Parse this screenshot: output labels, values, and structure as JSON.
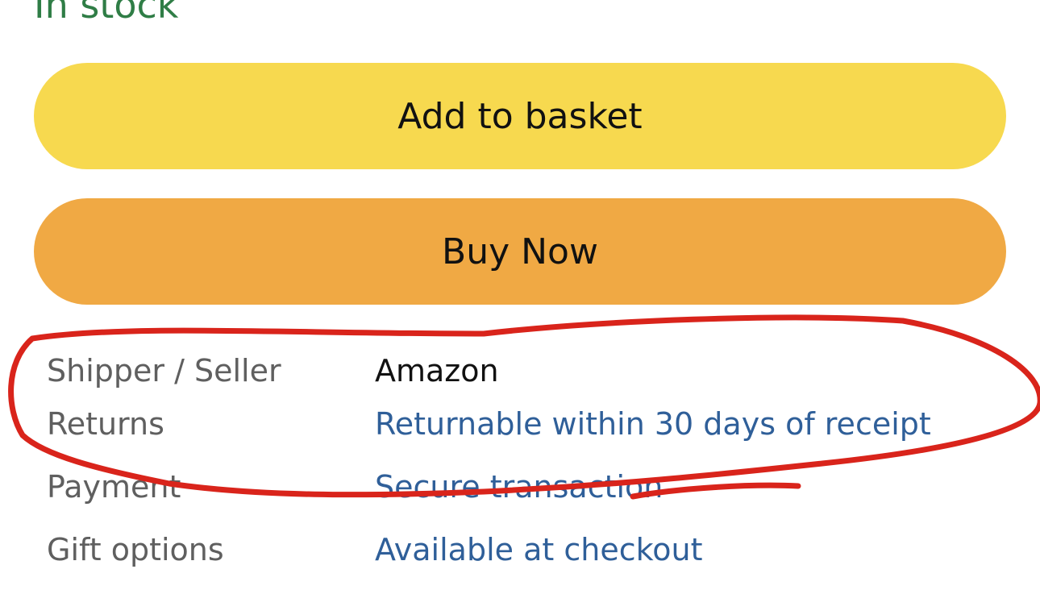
{
  "availability": {
    "status": "In stock"
  },
  "actions": {
    "add_to_basket_label": "Add to basket",
    "buy_now_label": "Buy Now"
  },
  "details": [
    {
      "label": "Shipper / Seller",
      "value": "Amazon"
    },
    {
      "label": "Returns",
      "value": "Returnable within 30 days of receipt"
    },
    {
      "label": "Payment",
      "value": "Secure transaction"
    },
    {
      "label": "Gift options",
      "value": "Available at checkout"
    }
  ],
  "colors": {
    "in_stock": "#2f7d46",
    "add_to_basket_bg": "#f7d94f",
    "buy_now_bg": "#f0a944",
    "label_text": "#5f5f5f",
    "link_text": "#2f5f99",
    "annotation_ink": "#d9241b"
  }
}
